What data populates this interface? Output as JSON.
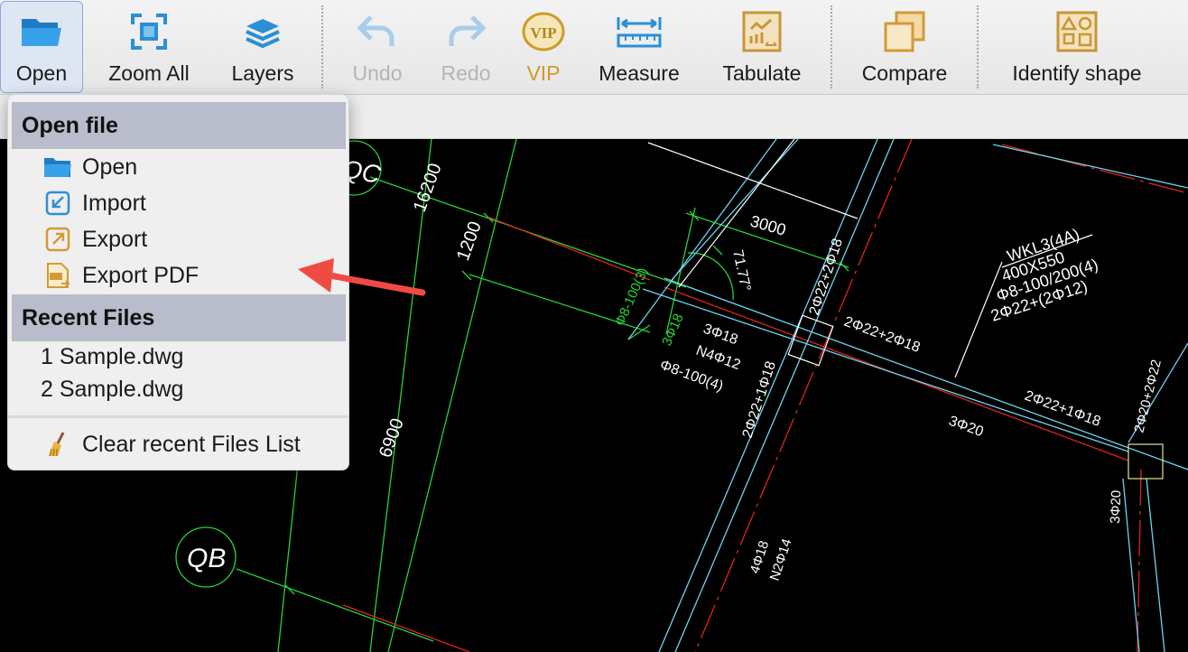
{
  "toolbar": {
    "open": "Open",
    "zoom_all": "Zoom All",
    "layers": "Layers",
    "undo": "Undo",
    "redo": "Redo",
    "vip": "VIP",
    "measure": "Measure",
    "tabulate": "Tabulate",
    "compare": "Compare",
    "identify_shape": "Identify shape",
    "vip_icon_text": "VIP"
  },
  "menu": {
    "open_file_header": "Open file",
    "items": [
      "Open",
      "Import",
      "Export",
      "Export PDF"
    ],
    "recent_header": "Recent Files",
    "recent": [
      "1 Sample.dwg",
      "2 Sample.dwg"
    ],
    "clear": "Clear recent Files List"
  },
  "drawing": {
    "axis_c": "QC",
    "axis_b": "QB",
    "dims": [
      "16200",
      "1200",
      "6900",
      "3000",
      "71.77°"
    ],
    "beam_title": "WKL3(4A)",
    "beam_size": "400X550",
    "beam_stirrup": "Φ8-100/200(4)",
    "beam_bars": "2Φ22+(2Φ12)",
    "lbl_phi8_100_3": "Φ8-100(3)",
    "lbl_3phi18_green": "3Φ18",
    "lbl_3phi18": "3Φ18",
    "lbl_n4": "N4Φ12",
    "lbl_phi8_100_4": "Φ8-100(4)",
    "lbl_2phi22_2phi18_a": "2Φ22+2Φ18",
    "lbl_2phi22_2phi18_b": "2Φ22+2Φ18",
    "lbl_2phi22_1phi18_a": "2Φ22+1Φ18",
    "lbl_2phi22_1phi18_b": "2Φ22+1Φ18",
    "lbl_3phi20_a": "3Φ20",
    "lbl_3phi20_b": "3Φ20",
    "lbl_2phi20_2phi22": "2Φ20+2Φ22",
    "lbl_4phi18": "4Φ18",
    "lbl_n2": "N2Φ14"
  },
  "colors": {
    "toolbar_icon_blue": "#2a8fd6",
    "vip_gold": "#d09a2a",
    "arrow_red": "#ef4b43",
    "cad_green": "#26d43a",
    "cad_red": "#e0241b",
    "cad_cyan": "#6fd3f2",
    "menu_header": "#b8bccb"
  }
}
